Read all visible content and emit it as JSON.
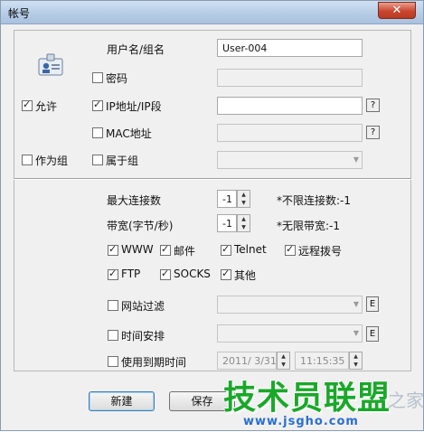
{
  "window": {
    "title": "帐号",
    "close_label": "✕"
  },
  "account": {
    "username_label": "用户名/组名",
    "username_value": "User-004",
    "password_label": "密码",
    "ip_label": "IP地址/IP段",
    "ip_value": "",
    "mac_label": "MAC地址",
    "group_label": "属于组",
    "allow_label": "允许",
    "as_group_label": "作为组",
    "help_symbol": "?"
  },
  "limits": {
    "max_conn_label": "最大连接数",
    "max_conn_value": "-1",
    "max_conn_hint": "*不限连接数:-1",
    "bandwidth_label": "带宽(字节/秒)",
    "bandwidth_value": "-1",
    "bandwidth_hint": "*无限带宽:-1"
  },
  "services": [
    "WWW",
    "邮件",
    "Telnet",
    "远程拨号",
    "FTP",
    "SOCKS",
    "其他"
  ],
  "filters": {
    "web_filter_label": "网站过滤",
    "schedule_label": "时间安排",
    "expire_label": "使用到期时间",
    "expire_date": "2011/ 3/31",
    "expire_time": "11:15:35",
    "edit_symbol": "E"
  },
  "buttons": {
    "new_label": "新建",
    "save_label": "保存"
  },
  "watermark": {
    "brand": "技术员联盟",
    "url": "www.jsgho.com",
    "suffix": "之家"
  }
}
